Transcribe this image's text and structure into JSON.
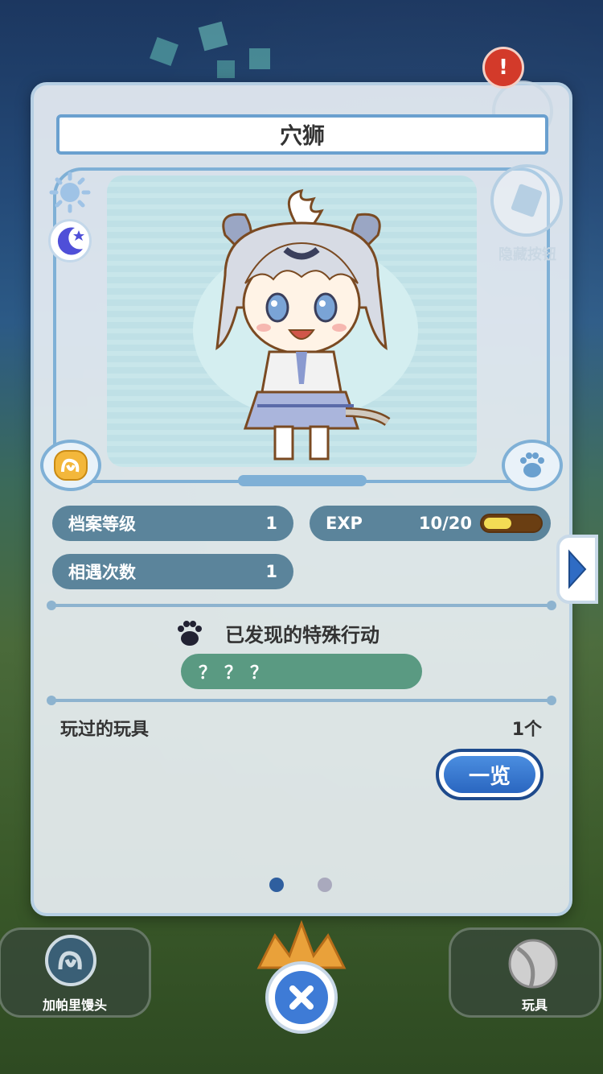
{
  "header": {
    "title": "穴狮",
    "alert_symbol": "!"
  },
  "side_buttons": {
    "hidden_label": "隐藏按钮"
  },
  "stats": {
    "profile_level_label": "档案等级",
    "profile_level_value": "1",
    "encounter_label": "相遇次数",
    "encounter_value": "1",
    "exp_label": "EXP",
    "exp_value": "10/20",
    "exp_progress": 0.5
  },
  "special_actions": {
    "title": "已发现的特殊行动",
    "items": [
      "？？？"
    ]
  },
  "toys": {
    "label": "玩过的玩具",
    "count": "1个",
    "list_button": "一览"
  },
  "pagination": {
    "current": 1,
    "total": 2
  },
  "bottom_nav": {
    "left_label": "加帕里馒头",
    "right_label": "玩具"
  },
  "colors": {
    "pill": "#5b849b",
    "special_pill": "#5a9a82",
    "accent_blue": "#3e7bd6",
    "exp_fill": "#f3dc54",
    "exp_track": "#6a3e12"
  }
}
